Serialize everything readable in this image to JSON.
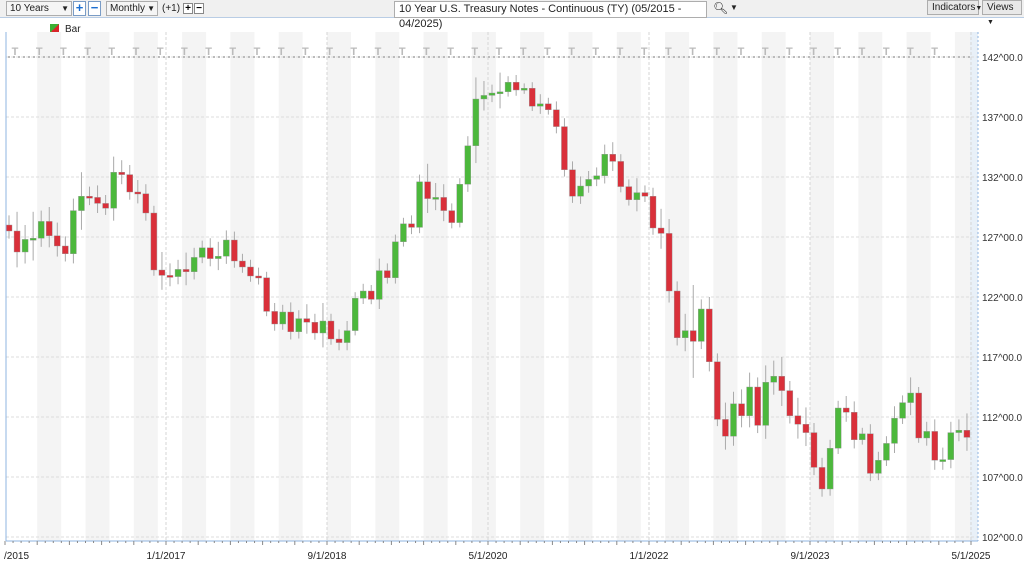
{
  "toolbar": {
    "range": "10 Years",
    "interval": "Monthly",
    "offset": "(+1)",
    "symbol_title": "10 Year U.S. Treasury Notes - Continuous (TY) (05/2015 - 04/2025)",
    "indicators": "Indicators",
    "views": "Views"
  },
  "legend": {
    "label": "Bar"
  },
  "colors": {
    "up": "#4cb83c",
    "down": "#d9303a",
    "wick": "#aaaaaa",
    "grid": "#dddddd",
    "band": "#f4f4f4",
    "axis": "#8fb4e0"
  },
  "chart_data": {
    "type": "candlestick",
    "title": "10 Year U.S. Treasury Notes - Continuous (TY) (05/2015 - 04/2025)",
    "interval": "monthly",
    "start": "2015-05",
    "end": "2025-04",
    "ylim": [
      102,
      142
    ],
    "yticks": [
      "142^00.0",
      "137^00.0",
      "132^00.0",
      "127^00.0",
      "122^00.0",
      "117^00.0",
      "112^00.0",
      "107^00.0",
      "102^00.0"
    ],
    "ytick_values": [
      142,
      137,
      132,
      127,
      122,
      117,
      112,
      107,
      102
    ],
    "xticks": [
      {
        "label": "/2015",
        "index": 0
      },
      {
        "label": "1/1/2017",
        "index": 20
      },
      {
        "label": "9/1/2018",
        "index": 40
      },
      {
        "label": "5/1/2020",
        "index": 60
      },
      {
        "label": "1/1/2022",
        "index": 80
      },
      {
        "label": "9/1/2023",
        "index": 100
      },
      {
        "label": "5/1/2025",
        "index": 120
      }
    ],
    "first_open": 128.0,
    "close": [
      127.5,
      125.75,
      126.8,
      126.9,
      128.3,
      127.1,
      126.25,
      125.6,
      129.2,
      130.4,
      130.3,
      129.8,
      129.4,
      132.4,
      132.2,
      130.75,
      130.6,
      129.0,
      124.25,
      123.8,
      123.7,
      124.3,
      124.1,
      125.3,
      126.1,
      125.2,
      125.4,
      126.75,
      125.0,
      124.5,
      123.75,
      123.6,
      120.8,
      119.75,
      120.75,
      119.1,
      120.2,
      119.9,
      119.0,
      120.0,
      118.5,
      118.2,
      119.2,
      121.9,
      122.5,
      121.8,
      124.2,
      123.6,
      126.6,
      128.1,
      127.8,
      131.6,
      130.2,
      130.3,
      129.2,
      128.2,
      131.4,
      134.6,
      138.5,
      138.8,
      139.0,
      139.1,
      139.9,
      139.25,
      139.4,
      137.9,
      138.1,
      137.6,
      136.2,
      132.6,
      130.4,
      131.25,
      131.8,
      132.1,
      133.9,
      133.3,
      131.2,
      130.1,
      130.7,
      130.4,
      127.75,
      127.3,
      122.5,
      118.6,
      119.2,
      118.3,
      121.0,
      116.6,
      111.8,
      110.4,
      113.1,
      112.1,
      114.5,
      111.3,
      114.9,
      115.4,
      114.2,
      112.1,
      111.4,
      110.7,
      107.8,
      106.0,
      109.4,
      112.75,
      112.4,
      110.1,
      110.6,
      107.3,
      108.4,
      109.8,
      111.9,
      113.2,
      114.0,
      110.25,
      110.8,
      108.4,
      108.45,
      110.7,
      110.9,
      110.3
    ],
    "wick": [
      0.8,
      1.6,
      1.2,
      2.2,
      0.9,
      1.2,
      1.1,
      0.8,
      1.0,
      2.0,
      0.8,
      1.0,
      0.7,
      1.3,
      1.0,
      0.8,
      1.0,
      0.8,
      0.6,
      1.5,
      1.0,
      0.8,
      1.4,
      0.8,
      0.6,
      0.8,
      1.2,
      0.8,
      0.7,
      0.6,
      0.6,
      0.7,
      0.5,
      0.7,
      0.6,
      0.8,
      0.7,
      1.2,
      0.7,
      1.5,
      0.6,
      0.8,
      0.8,
      0.5,
      0.6,
      0.5,
      1.0,
      0.6,
      0.6,
      0.5,
      0.7,
      0.6,
      1.5,
      1.2,
      1.1,
      0.6,
      0.5,
      0.8,
      1.8,
      1.2,
      0.7,
      1.6,
      0.5,
      0.6,
      0.4,
      0.5,
      0.8,
      0.5,
      0.7,
      0.7,
      0.7,
      0.8,
      0.7,
      0.7,
      0.8,
      1.0,
      0.6,
      0.6,
      1.2,
      0.6,
      0.7,
      1.6,
      1.2,
      0.8,
      1.4,
      3.8,
      0.8,
      1.0,
      0.7,
      1.4,
      1.0,
      1.2,
      1.2,
      0.8,
      1.4,
      1.3,
      1.6,
      0.8,
      1.5,
      1.4,
      0.8,
      0.8,
      0.7,
      0.6,
      1.0,
      0.9,
      0.5,
      0.8,
      0.7,
      0.6,
      1.0,
      0.6,
      1.3,
      0.5,
      0.8,
      1.0,
      1.0,
      0.9,
      0.9,
      1.4
    ]
  }
}
